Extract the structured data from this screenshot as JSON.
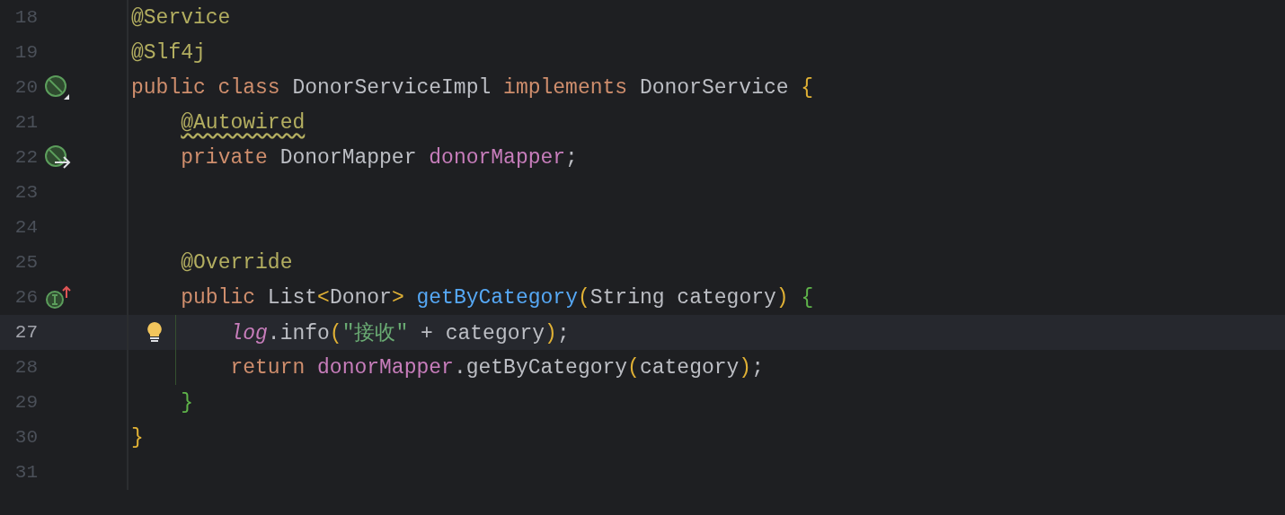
{
  "editor": {
    "lines": [
      {
        "number": "18",
        "current": false,
        "tokens": [
          {
            "text": "@Service",
            "kind": "annotation"
          }
        ]
      },
      {
        "number": "19",
        "current": false,
        "tokens": [
          {
            "text": "@Slf4j",
            "kind": "annotation"
          }
        ]
      },
      {
        "number": "20",
        "current": false,
        "gutter_icon": {
          "kind": "bean"
        },
        "tokens": [
          {
            "text": "public class ",
            "kind": "keyword"
          },
          {
            "text": "DonorServiceImpl ",
            "kind": "plain"
          },
          {
            "text": "implements ",
            "kind": "keyword"
          },
          {
            "text": "DonorService ",
            "kind": "plain"
          },
          {
            "text": "{",
            "kind": "brace1"
          }
        ]
      },
      {
        "number": "21",
        "current": false,
        "tokens": [
          {
            "text": "    @Autowired",
            "kind": "annotation",
            "warning": true
          }
        ]
      },
      {
        "number": "22",
        "current": false,
        "gutter_icon": {
          "kind": "bean-inject"
        },
        "tokens": [
          {
            "text": "    private ",
            "kind": "keyword"
          },
          {
            "text": "DonorMapper ",
            "kind": "plain"
          },
          {
            "text": "donorMapper",
            "kind": "field"
          },
          {
            "text": ";",
            "kind": "plain"
          }
        ]
      },
      {
        "number": "23",
        "current": false
      },
      {
        "number": "24",
        "current": false
      },
      {
        "number": "25",
        "current": false,
        "tokens": [
          {
            "text": "    @Override",
            "kind": "annotation"
          }
        ]
      },
      {
        "number": "26",
        "current": false,
        "gutter_icon": {
          "kind": "implements"
        },
        "tokens": [
          {
            "text": "    public ",
            "kind": "keyword"
          },
          {
            "text": "List",
            "kind": "plain"
          },
          {
            "text": "<",
            "kind": "brace1"
          },
          {
            "text": "Donor",
            "kind": "plain"
          },
          {
            "text": "> ",
            "kind": "brace1"
          },
          {
            "text": "getByCategory",
            "kind": "method"
          },
          {
            "text": "(",
            "kind": "brace1"
          },
          {
            "text": "String category",
            "kind": "plain"
          },
          {
            "text": ") ",
            "kind": "brace1"
          },
          {
            "text": "{",
            "kind": "brace2"
          }
        ]
      },
      {
        "number": "27",
        "current": true,
        "bulb": true,
        "tokens": [
          {
            "text": "        log",
            "kind": "static"
          },
          {
            "text": ".info",
            "kind": "plain"
          },
          {
            "text": "(",
            "kind": "brace1"
          },
          {
            "text": "\"接收\"",
            "kind": "string"
          },
          {
            "text": " + category",
            "kind": "plain"
          },
          {
            "text": ")",
            "kind": "brace1"
          },
          {
            "text": ";",
            "kind": "plain"
          }
        ]
      },
      {
        "number": "28",
        "current": false,
        "tokens": [
          {
            "text": "        return ",
            "kind": "keyword"
          },
          {
            "text": "donorMapper",
            "kind": "field"
          },
          {
            "text": ".getByCategory",
            "kind": "plain"
          },
          {
            "text": "(",
            "kind": "brace1"
          },
          {
            "text": "category",
            "kind": "plain"
          },
          {
            "text": ")",
            "kind": "brace1"
          },
          {
            "text": ";",
            "kind": "plain"
          }
        ]
      },
      {
        "number": "29",
        "current": false,
        "tokens": [
          {
            "text": "    }",
            "kind": "brace2"
          }
        ]
      },
      {
        "number": "30",
        "current": false,
        "tokens": [
          {
            "text": "}",
            "kind": "brace1"
          }
        ]
      },
      {
        "number": "31",
        "current": false
      }
    ]
  }
}
